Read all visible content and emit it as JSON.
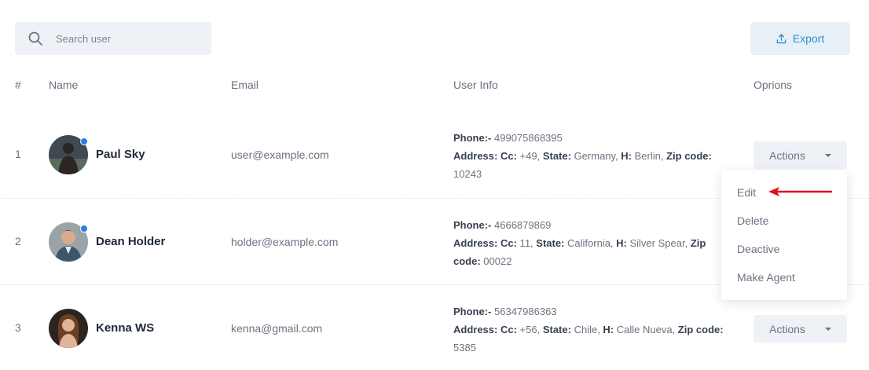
{
  "search": {
    "placeholder": "Search user"
  },
  "toolbar": {
    "export_label": "Export"
  },
  "table": {
    "headers": {
      "index": "#",
      "name": "Name",
      "email": "Email",
      "user_info": "User Info",
      "options": "Oprions"
    },
    "rows": [
      {
        "index": "1",
        "name": "Paul Sky",
        "email": "user@example.com",
        "phone_label": "Phone:-",
        "phone": " 499075868395",
        "address_label": "Address:",
        "cc_label": "Cc:",
        "cc": " +49, ",
        "state_label": "State:",
        "state": " Germany, ",
        "h_label": "H:",
        "h": " Berlin, ",
        "zip_label": "Zip code:",
        "zip": " 10243",
        "online": true
      },
      {
        "index": "2",
        "name": "Dean Holder",
        "email": "holder@example.com",
        "phone_label": "Phone:-",
        "phone": " 4666879869",
        "address_label": "Address:",
        "cc_label": "Cc:",
        "cc": " 11, ",
        "state_label": "State:",
        "state": " California, ",
        "h_label": "H:",
        "h": " Silver Spear, ",
        "zip_label": "Zip code:",
        "zip": " 00022",
        "online": true
      },
      {
        "index": "3",
        "name": "Kenna WS",
        "email": "kenna@gmail.com",
        "phone_label": "Phone:-",
        "phone": " 56347986363",
        "address_label": "Address:",
        "cc_label": "Cc:",
        "cc": " +56, ",
        "state_label": "State:",
        "state": " Chile, ",
        "h_label": "H:",
        "h": " Calle Nueva, ",
        "zip_label": "Zip code:",
        "zip": " 5385",
        "online": false
      }
    ],
    "actions_label": "Actions"
  },
  "dropdown": {
    "items": [
      "Edit",
      "Delete",
      "Deactive",
      "Make Agent"
    ]
  },
  "colors": {
    "accent": "#2a8ed6",
    "status_dot": "#2a7de1",
    "arrow": "#e0121b"
  },
  "icons": {
    "search": "search-icon",
    "export": "upload-icon",
    "caret": "caret-down-icon"
  }
}
